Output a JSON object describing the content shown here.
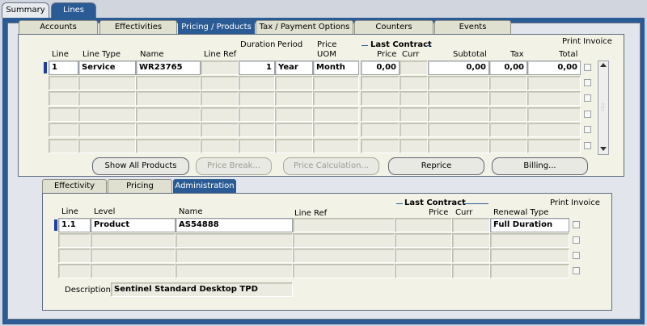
{
  "top_tabs": [
    "Summary",
    "Lines"
  ],
  "line_tabs": [
    "Accounts",
    "Effectivities",
    "Pricing / Products",
    "Tax / Payment Options",
    "Counters",
    "Events"
  ],
  "lines": {
    "headers": {
      "line": "Line",
      "line_type": "Line Type",
      "name": "Name",
      "line_ref": "Line Ref",
      "duration": "Duration",
      "period": "Period",
      "price_uom_1": "Price",
      "price_uom_2": "UOM",
      "last_contract": "Last Contract",
      "price": "Price",
      "curr": "Curr",
      "subtotal": "Subtotal",
      "tax": "Tax",
      "total": "Total",
      "print_invoice": "Print Invoice"
    },
    "row1": {
      "line": "1",
      "line_type": "Service",
      "name": "WR23765",
      "line_ref": "",
      "duration": "1",
      "period": "Year",
      "uom": "Month",
      "price": "0,00",
      "curr": "",
      "subtotal": "0,00",
      "tax": "0,00",
      "total": "0,00"
    }
  },
  "buttons": {
    "show_all": "Show All Products",
    "price_break": "Price Break...",
    "price_calc": "Price Calculation...",
    "reprice": "Reprice",
    "billing": "Billing..."
  },
  "sub_tabs": [
    "Effectivity",
    "Pricing",
    "Administration"
  ],
  "sublines": {
    "headers": {
      "line": "Line",
      "level": "Level",
      "name": "Name",
      "line_ref": "Line Ref",
      "last_contract": "Last Contract",
      "price": "Price",
      "curr": "Curr",
      "renewal_type": "Renewal Type",
      "print_invoice": "Print Invoice"
    },
    "row1": {
      "line": "1.1",
      "level": "Product",
      "name": "AS54888",
      "line_ref": "",
      "price": "",
      "curr": "",
      "renewal_type": "Full Duration"
    }
  },
  "description": {
    "label": "Description",
    "value": "Sentinel Standard Desktop TPD"
  }
}
